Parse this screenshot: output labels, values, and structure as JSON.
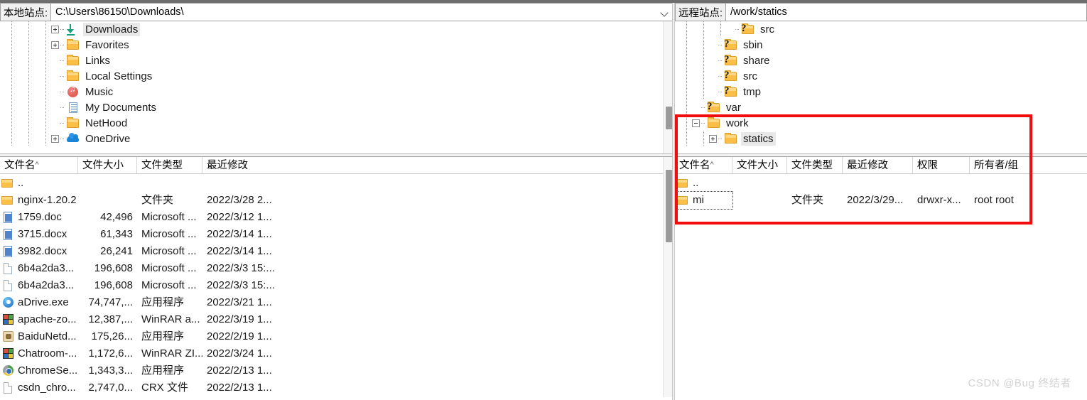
{
  "local": {
    "path_label": "本地站点:",
    "path_value": "C:\\Users\\86150\\Downloads\\",
    "tree": [
      {
        "label": "Downloads",
        "icon": "download-icon",
        "expander": "plus",
        "indent": 3,
        "selected": true
      },
      {
        "label": "Favorites",
        "icon": "folder-icon",
        "expander": "plus",
        "indent": 3,
        "selected": false
      },
      {
        "label": "Links",
        "icon": "folder-icon",
        "expander": "none",
        "indent": 3,
        "selected": false
      },
      {
        "label": "Local Settings",
        "icon": "folder-icon",
        "expander": "none",
        "indent": 3,
        "selected": false
      },
      {
        "label": "Music",
        "icon": "music-icon",
        "expander": "none",
        "indent": 3,
        "selected": false
      },
      {
        "label": "My Documents",
        "icon": "document-icon",
        "expander": "none",
        "indent": 3,
        "selected": false
      },
      {
        "label": "NetHood",
        "icon": "folder-icon",
        "expander": "none",
        "indent": 3,
        "selected": false
      },
      {
        "label": "OneDrive",
        "icon": "cloud-icon",
        "expander": "plus",
        "indent": 3,
        "selected": false
      }
    ],
    "columns": [
      "文件名",
      "文件大小",
      "文件类型",
      "最近修改"
    ],
    "sort_indicator": "^",
    "rows": [
      {
        "name": "..",
        "size": "",
        "type": "",
        "modified": "",
        "icon": "folder-icon"
      },
      {
        "name": "nginx-1.20.2",
        "size": "",
        "type": "文件夹",
        "modified": "2022/3/28 2...",
        "icon": "folder-icon"
      },
      {
        "name": "1759.doc",
        "size": "42,496",
        "type": "Microsoft ...",
        "modified": "2022/3/12 1...",
        "icon": "word-icon"
      },
      {
        "name": "3715.docx",
        "size": "61,343",
        "type": "Microsoft ...",
        "modified": "2022/3/14 1...",
        "icon": "word-icon"
      },
      {
        "name": "3982.docx",
        "size": "26,241",
        "type": "Microsoft ...",
        "modified": "2022/3/14 1...",
        "icon": "word-icon"
      },
      {
        "name": "6b4a2da3...",
        "size": "196,608",
        "type": "Microsoft ...",
        "modified": "2022/3/3 15:...",
        "icon": "doc-icon"
      },
      {
        "name": "6b4a2da3...",
        "size": "196,608",
        "type": "Microsoft ...",
        "modified": "2022/3/3 15:...",
        "icon": "doc-icon"
      },
      {
        "name": "aDrive.exe",
        "size": "74,747,...",
        "type": "应用程序",
        "modified": "2022/3/21 1...",
        "icon": "adrive-icon"
      },
      {
        "name": "apache-zo...",
        "size": "12,387,...",
        "type": "WinRAR a...",
        "modified": "2022/3/19 1...",
        "icon": "winrar-icon"
      },
      {
        "name": "BaiduNetd...",
        "size": "175,26...",
        "type": "应用程序",
        "modified": "2022/2/19 1...",
        "icon": "baidu-icon"
      },
      {
        "name": "Chatroom-...",
        "size": "1,172,6...",
        "type": "WinRAR ZI...",
        "modified": "2022/3/24 1...",
        "icon": "winrar-icon"
      },
      {
        "name": "ChromeSe...",
        "size": "1,343,3...",
        "type": "应用程序",
        "modified": "2022/2/13 1...",
        "icon": "chrome-icon"
      },
      {
        "name": "csdn_chro...",
        "size": "2,747,0...",
        "type": "CRX 文件",
        "modified": "2022/2/13 1...",
        "icon": "crx-icon"
      }
    ]
  },
  "remote": {
    "path_label": "远程站点:",
    "path_value": "/work/statics",
    "tree": [
      {
        "label": "src",
        "icon": "folder-unknown-icon",
        "expander": "none",
        "indent": 3,
        "selected": false
      },
      {
        "label": "sbin",
        "icon": "folder-unknown-icon",
        "expander": "none",
        "indent": 2,
        "selected": false
      },
      {
        "label": "share",
        "icon": "folder-unknown-icon",
        "expander": "none",
        "indent": 2,
        "selected": false
      },
      {
        "label": "src",
        "icon": "folder-unknown-icon",
        "expander": "none",
        "indent": 2,
        "selected": false
      },
      {
        "label": "tmp",
        "icon": "folder-unknown-icon",
        "expander": "none",
        "indent": 2,
        "selected": false
      },
      {
        "label": "var",
        "icon": "folder-unknown-icon",
        "expander": "none",
        "indent": 1,
        "selected": false
      },
      {
        "label": "work",
        "icon": "folder-icon",
        "expander": "minus",
        "indent": 1,
        "selected": false
      },
      {
        "label": "statics",
        "icon": "folder-icon",
        "expander": "plus",
        "indent": 2,
        "selected": true
      }
    ],
    "columns": [
      "文件名",
      "文件大小",
      "文件类型",
      "最近修改",
      "权限",
      "所有者/组"
    ],
    "sort_indicator": "^",
    "rows": [
      {
        "name": "..",
        "size": "",
        "type": "",
        "modified": "",
        "perms": "",
        "owner": "",
        "icon": "folder-icon",
        "focused": false
      },
      {
        "name": "mi",
        "size": "",
        "type": "文件夹",
        "modified": "2022/3/29...",
        "perms": "drwxr-x...",
        "owner": "root root",
        "icon": "folder-icon",
        "focused": true
      }
    ]
  },
  "annotations": {
    "highlight_color": "#f30c0c"
  },
  "watermark": "CSDN @Bug 终结者"
}
